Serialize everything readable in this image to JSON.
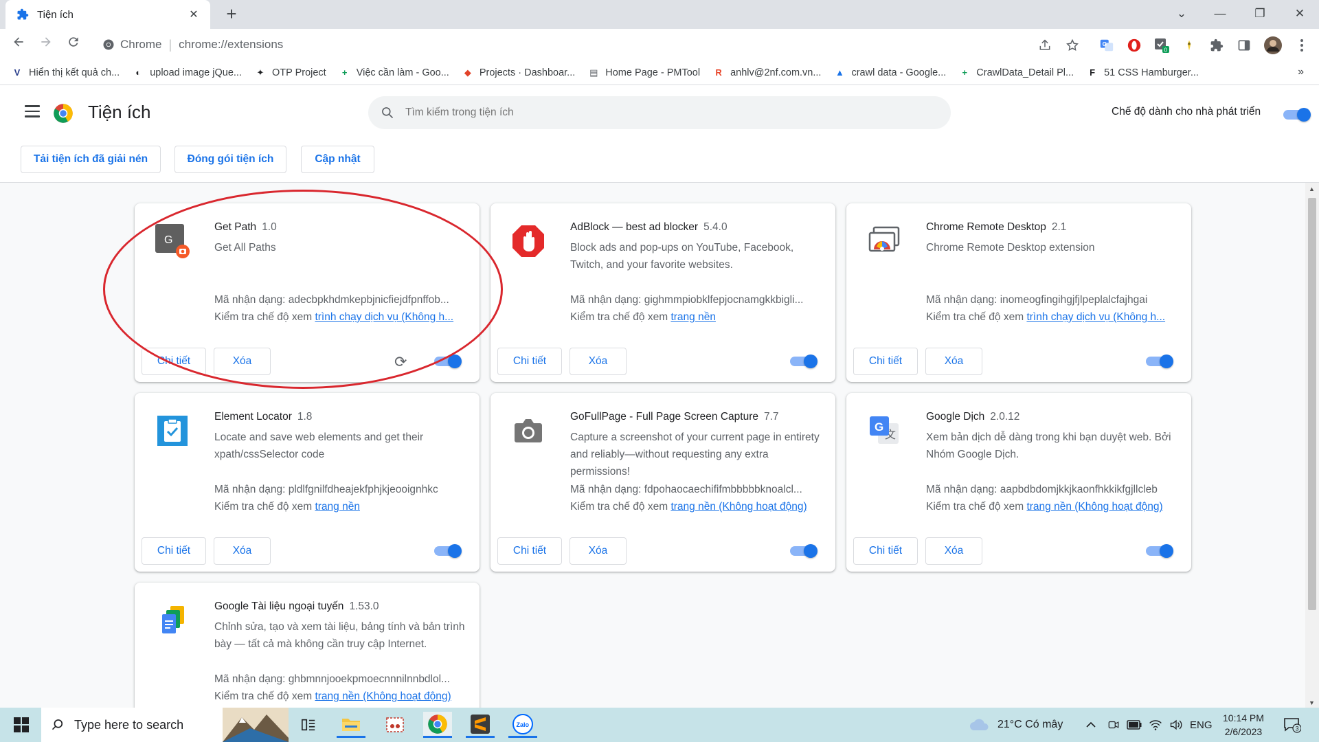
{
  "tab": {
    "title": "Tiện ích",
    "close": "✕",
    "new_tab": "+"
  },
  "window": {
    "minimize": "⌄",
    "min": "—",
    "restore": "❐",
    "close": "✕"
  },
  "omnibox": {
    "site": "Chrome",
    "url": "chrome://extensions"
  },
  "bookmarks": [
    {
      "label": "Hiển thị kết quả ch...",
      "icon": "V",
      "color": "#2a3e8c"
    },
    {
      "label": "upload image jQue...",
      "icon": "◐",
      "color": "#202124"
    },
    {
      "label": "OTP Project",
      "icon": "✦",
      "color": "#202124"
    },
    {
      "label": "Việc cần làm - Goo...",
      "icon": "+",
      "color": "#0f9d58"
    },
    {
      "label": "Projects · Dashboar...",
      "icon": "◆",
      "color": "#e24329"
    },
    {
      "label": "Home Page - PMTool",
      "icon": "▤",
      "color": "#5f6368"
    },
    {
      "label": "anhlv@2nf.com.vn...",
      "icon": "R",
      "color": "#e8472c"
    },
    {
      "label": "crawl data - Google...",
      "icon": "▲",
      "color": "#1a73e8"
    },
    {
      "label": "CrawlData_Detail Pl...",
      "icon": "+",
      "color": "#0f9d58"
    },
    {
      "label": "51 CSS Hamburger...",
      "icon": "F",
      "color": "#202124"
    }
  ],
  "bookmarks_more": "»",
  "header": {
    "title": "Tiện ích",
    "search_placeholder": "Tìm kiếm trong tiện ích",
    "dev_mode_label": "Chế độ dành cho nhà phát triển",
    "dev_mode_on": true,
    "load_unpacked": "Tải tiện ích đã giải nén",
    "pack": "Đóng gói tiện ích",
    "update": "Cập nhật"
  },
  "labels": {
    "details": "Chi tiết",
    "remove": "Xóa",
    "id_prefix": "Mã nhận dạng: ",
    "inspect_prefix": "Kiểm tra chế độ xem "
  },
  "extensions": [
    {
      "name": "Get Path",
      "version": "1.0",
      "description": "Get All Paths",
      "id": "adecbpkhdmkepbjnicfiejdfpnffob...",
      "inspect_link": "trình chạy dịch vụ (Không h...",
      "enabled": true,
      "icon": "get-path-icon"
    },
    {
      "name": "AdBlock — best ad blocker",
      "version": "5.4.0",
      "description": "Block ads and pop-ups on YouTube, Facebook, Twitch, and your favorite websites.",
      "id": "gighmmpiobklfepjocnamgkkbigli...",
      "inspect_link": "trang nền",
      "enabled": true,
      "icon": "adblock-icon"
    },
    {
      "name": "Chrome Remote Desktop",
      "version": "2.1",
      "description": "Chrome Remote Desktop extension",
      "id": "inomeogfingihgjfjlpeplalcfajhgai",
      "inspect_link": "trình chạy dịch vụ (Không h...",
      "enabled": true,
      "icon": "remote-desktop-icon"
    },
    {
      "name": "Element Locator",
      "version": "1.8",
      "description": "Locate and save web elements and get their xpath/cssSelector code",
      "id": "pldlfgnilfdheajekfphjkjeooignhkc",
      "inspect_link": "trang nền",
      "enabled": true,
      "icon": "element-locator-icon"
    },
    {
      "name": "GoFullPage - Full Page Screen Capture",
      "version": "7.7",
      "description": "Capture a screenshot of your current page in entirety and reliably—without requesting any extra permissions!",
      "id": "fdpohaocaechififmbbbbbknoalcl...",
      "inspect_link": "trang nền (Không hoạt động)",
      "enabled": true,
      "icon": "camera-icon"
    },
    {
      "name": "Google Dịch",
      "version": "2.0.12",
      "description": "Xem bản dịch dễ dàng trong khi bạn duyệt web. Bởi Nhóm Google Dịch.",
      "id": "aapbdbdomjkkjkaonfhkkikfgjllcleb",
      "inspect_link": "trang nền (Không hoạt động)",
      "enabled": true,
      "icon": "google-translate-icon"
    },
    {
      "name": "Google Tài liệu ngoại tuyến",
      "version": "1.53.0",
      "description": "Chỉnh sửa, tạo và xem tài liệu, bảng tính và bản trình bày — tất cả mà không cần truy cập Internet.",
      "id": "ghbmnnjooekpmoecnnnilnnbdlol...",
      "inspect_link": "trang nền (Không hoạt động)",
      "enabled": true,
      "icon": "google-docs-icon"
    }
  ],
  "taskbar": {
    "search_placeholder": "Type here to search",
    "weather": "21°C  Có mây",
    "lang": "ENG",
    "time": "10:14 PM",
    "date": "2/6/2023",
    "notif_count": "3",
    "zalo_label": "Zalo"
  },
  "colors": {
    "accent": "#1a73e8",
    "annotation": "#d9272e",
    "taskbar": "#c6e3e8"
  }
}
